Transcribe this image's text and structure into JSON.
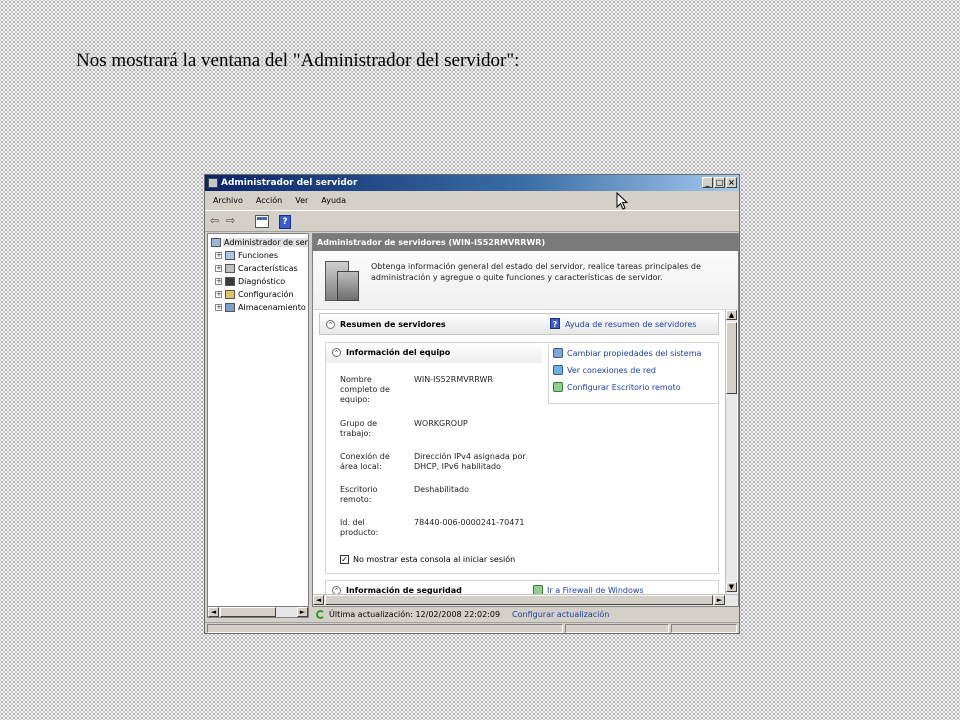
{
  "caption": "Nos mostrará la ventana del \"Administrador del servidor\":",
  "window": {
    "title": "Administrador del servidor",
    "buttons": {
      "minimize": "_",
      "maximize": "□",
      "close": "×"
    },
    "menu": [
      "Archivo",
      "Acción",
      "Ver",
      "Ayuda"
    ],
    "toolbar": {
      "back": "⇦",
      "forward": "⇨",
      "help": "?"
    }
  },
  "tree": {
    "root": "Administrador de ser",
    "items": [
      {
        "label": "Funciones",
        "expander": "+"
      },
      {
        "label": "Características",
        "expander": "+"
      },
      {
        "label": "Diagnóstico",
        "expander": "+"
      },
      {
        "label": "Configuración",
        "expander": "+"
      },
      {
        "label": "Almacenamiento",
        "expander": "+"
      }
    ]
  },
  "main": {
    "header": "Administrador de servidores (WIN-IS52RMVRRWR)",
    "intro": "Obtenga información general del estado del servidor, realice tareas principales de administración y agregue o quite funciones y características de servidor.",
    "summary": {
      "toggle": "⌃",
      "title": "Resumen de servidores",
      "help_icon": "?",
      "help_link": "Ayuda de resumen de servidores"
    },
    "computer_info": {
      "toggle": "⌃",
      "title": "Información del equipo",
      "tasks": [
        {
          "label": "Cambiar propiedades del sistema",
          "icon": "system-properties-icon"
        },
        {
          "label": "Ver conexiones de red",
          "icon": "network-icon"
        },
        {
          "label": "Configurar Escritorio remoto",
          "icon": "remote-desktop-icon"
        }
      ],
      "properties": [
        {
          "label": "Nombre completo de equipo:",
          "value": "WIN-IS52RMVRRWR"
        },
        {
          "label": "Grupo de trabajo:",
          "value": "WORKGROUP"
        },
        {
          "label": "Conexión de área local:",
          "value": "Dirección IPv4 asignada por DHCP, IPv6 habilitado"
        },
        {
          "label": "Escritorio remoto:",
          "value": "Deshabilitado"
        },
        {
          "label": "Id. del producto:",
          "value": "78440-006-0000241-70471"
        }
      ],
      "checkbox": {
        "checked": true,
        "mark": "✓",
        "label": "No mostrar esta consola al iniciar sesión"
      }
    },
    "security_info": {
      "toggle": "⌃",
      "title": "Información de seguridad",
      "task": "Ir a Firewall de Windows"
    }
  },
  "scroll": {
    "up": "▲",
    "down": "▼",
    "left": "◄",
    "right": "►"
  },
  "status": {
    "last_update": "Última actualización: 12/02/2008 22:02:09",
    "configure_link": "Configurar actualización"
  }
}
